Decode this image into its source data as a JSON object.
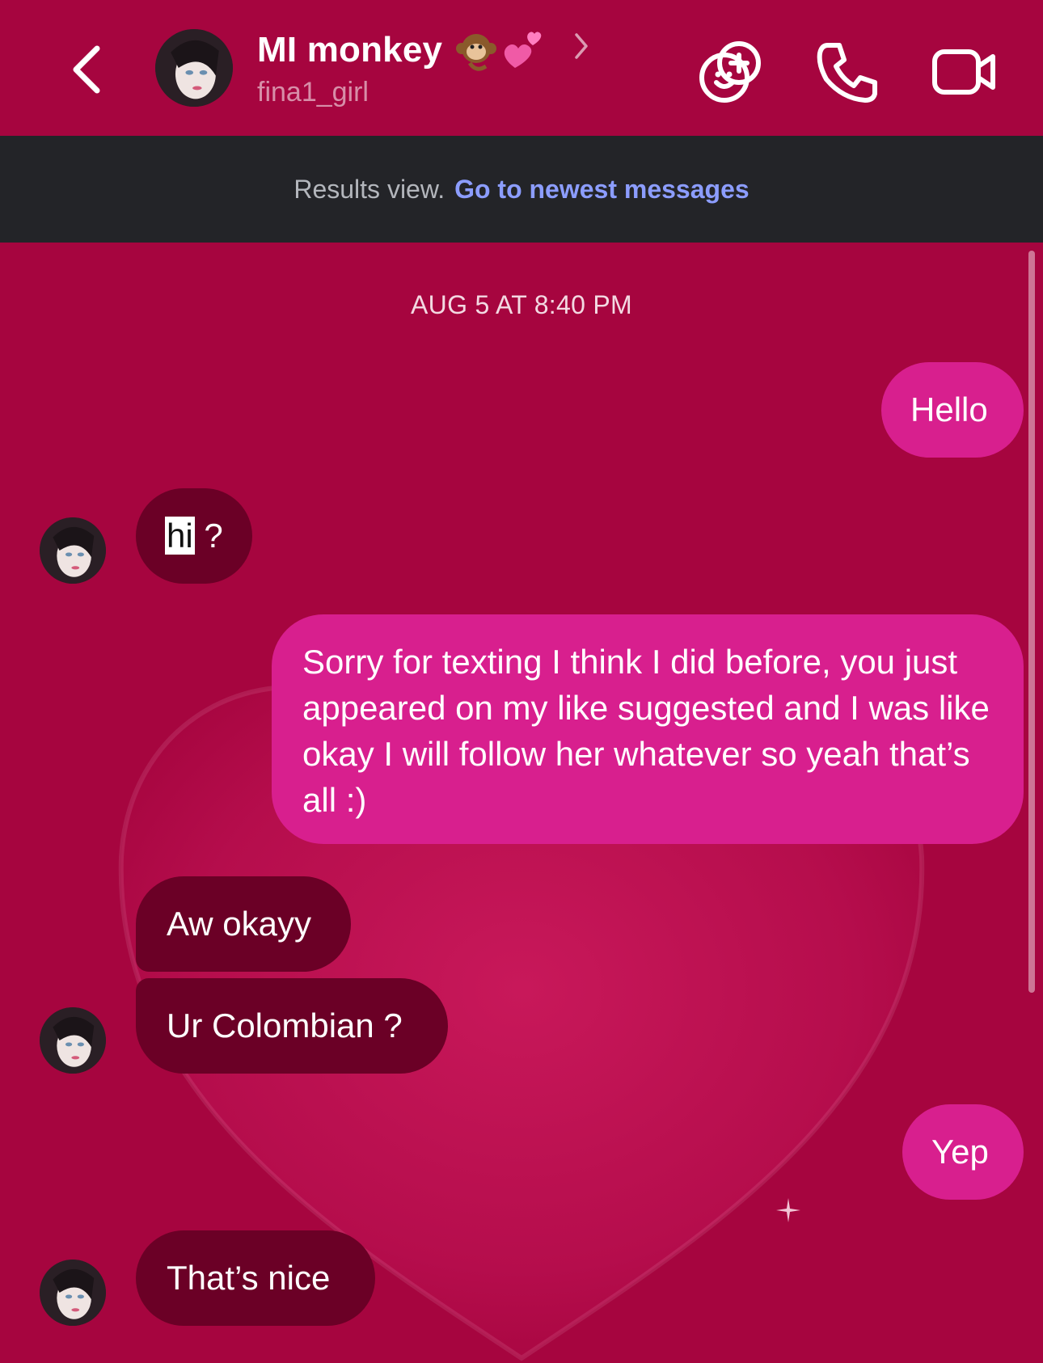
{
  "header": {
    "title": "MI monkey",
    "username": "fina1_girl",
    "title_emojis": [
      "monkey-emoji",
      "two-hearts-emoji"
    ],
    "icons": [
      "back-arrow-icon",
      "chevron-right-icon",
      "games-icon",
      "phone-icon",
      "video-camera-icon"
    ]
  },
  "banner": {
    "text": "Results view.",
    "link": "Go to newest messages"
  },
  "chat": {
    "timestamp": "AUG 5 AT 8:40 PM",
    "messages": [
      {
        "sender": "me",
        "text": "Hello"
      },
      {
        "sender": "them",
        "highlighted": "hi",
        "text_after": " ?"
      },
      {
        "sender": "me",
        "text": "Sorry for texting I think I did before, you just appeared on my like suggested and I was like okay I will follow her whatever so yeah that’s all :)"
      },
      {
        "sender": "them",
        "text": "Aw okayy"
      },
      {
        "sender": "them",
        "text": "Ur Colombian ?"
      },
      {
        "sender": "me",
        "text": "Yep"
      },
      {
        "sender": "them",
        "text": "That’s nice"
      }
    ]
  },
  "colors": {
    "background": "#a6053f",
    "outgoing_bubble": "#d81f8e",
    "incoming_bubble": "#6b0026",
    "banner_bg": "#232428",
    "link": "#8c9dff"
  }
}
